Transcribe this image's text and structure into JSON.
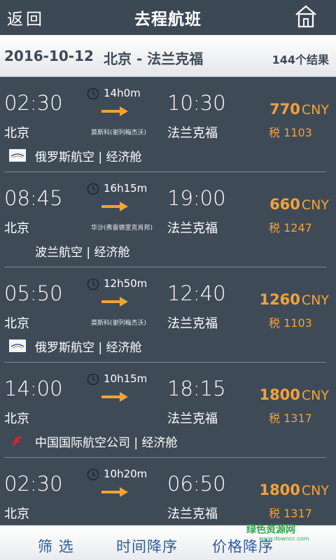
{
  "header": {
    "back_label": "返回",
    "title": "去程航班",
    "home_icon": "home-icon"
  },
  "summary": {
    "date": "2016-10-12",
    "route": "北京 - 法兰克福",
    "result_count": "144个结果"
  },
  "flights": [
    {
      "dep_time": "02:30",
      "duration": "14h0m",
      "arr_time": "10:30",
      "dep_city": "北京",
      "via": "莫斯科(谢列梅杰沃)",
      "arr_city": "法兰克福",
      "price": "770",
      "currency": "CNY",
      "tax": "税 1103",
      "airline": "俄罗斯航空 | 经济舱",
      "logo": "aeroflot"
    },
    {
      "dep_time": "08:45",
      "duration": "16h15m",
      "arr_time": "19:00",
      "dep_city": "北京",
      "via": "华沙(弗雷德里克肖邦)",
      "arr_city": "法兰克福",
      "price": "660",
      "currency": "CNY",
      "tax": "税 1247",
      "airline": "波兰航空 | 经济舱",
      "logo": ""
    },
    {
      "dep_time": "05:50",
      "duration": "12h50m",
      "arr_time": "12:40",
      "dep_city": "北京",
      "via": "莫斯科(谢列梅杰沃)",
      "arr_city": "法兰克福",
      "price": "1260",
      "currency": "CNY",
      "tax": "税 1103",
      "airline": "俄罗斯航空 | 经济舱",
      "logo": "aeroflot"
    },
    {
      "dep_time": "14:00",
      "duration": "10h15m",
      "arr_time": "18:15",
      "dep_city": "北京",
      "via": "",
      "arr_city": "法兰克福",
      "price": "1800",
      "currency": "CNY",
      "tax": "税 1317",
      "airline": "中国国际航空公司 | 经济舱",
      "logo": "airchina"
    },
    {
      "dep_time": "02:30",
      "duration": "10h20m",
      "arr_time": "06:50",
      "dep_city": "北京",
      "via": "",
      "arr_city": "法兰克福",
      "price": "1800",
      "currency": "CNY",
      "tax": "税 1317",
      "airline": "",
      "logo": ""
    }
  ],
  "footer": {
    "filter_label": "筛 选",
    "time_sort_label": "时间降序",
    "price_sort_label": "价格降序"
  },
  "watermark": {
    "text": "绿色资源网",
    "sub": "www.downcc.com"
  },
  "colors": {
    "background": "#3f4a57",
    "accent": "#f2a23a",
    "footer_text": "#2e5c9a"
  }
}
